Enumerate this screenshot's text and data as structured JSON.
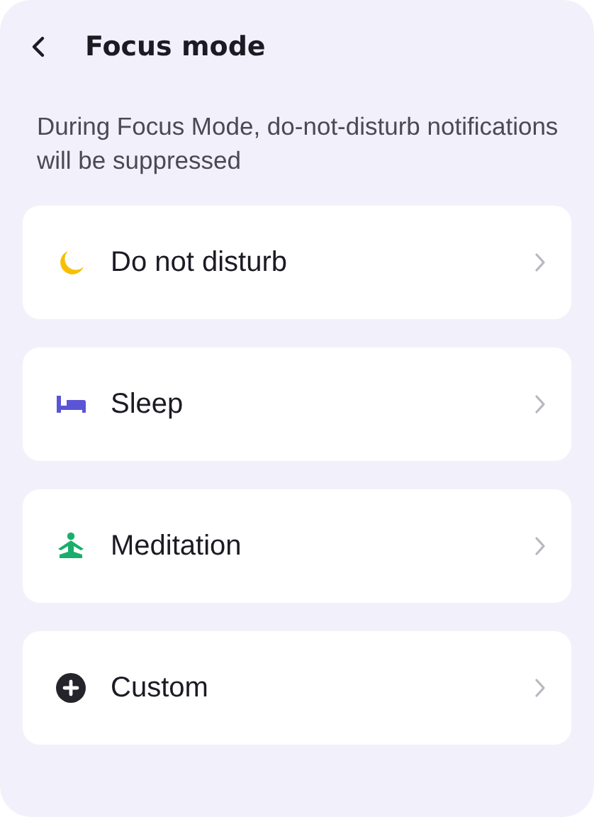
{
  "header": {
    "title": "Focus mode"
  },
  "description": "During Focus Mode, do-not-disturb notifications will be suppressed",
  "items": [
    {
      "kind": "moon",
      "label": "Do not disturb"
    },
    {
      "kind": "bed",
      "label": "Sleep"
    },
    {
      "kind": "meditation",
      "label": "Meditation"
    },
    {
      "kind": "plus",
      "label": "Custom"
    }
  ]
}
